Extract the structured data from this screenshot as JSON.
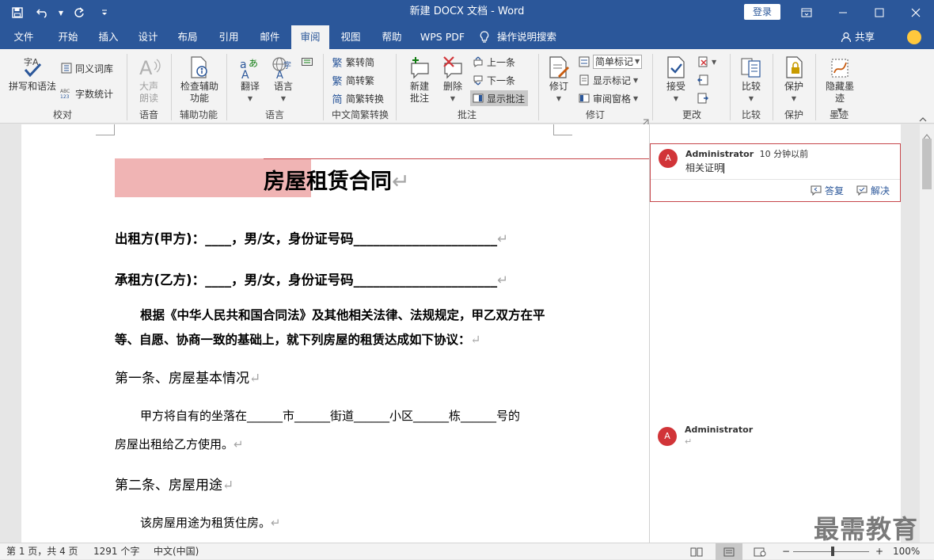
{
  "window": {
    "title": "新建 DOCX 文档 - Word",
    "login_label": "登录"
  },
  "tabs": [
    "文件",
    "开始",
    "插入",
    "设计",
    "布局",
    "引用",
    "邮件",
    "审阅",
    "视图",
    "帮助",
    "WPS PDF",
    "操作说明搜索"
  ],
  "active_tab": "审阅",
  "share_label": "共享",
  "ribbon": {
    "proofing": {
      "label": "校对",
      "spelling": "拼写和语法",
      "thesaurus": "同义词库",
      "wordcount": "字数统计"
    },
    "speech": {
      "label": "语音",
      "read_aloud": "大声朗读"
    },
    "accessibility": {
      "label": "辅助功能",
      "check": "检查辅助功能"
    },
    "language": {
      "label": "语言",
      "translate": "翻译",
      "language": "语言"
    },
    "chinese": {
      "label": "中文简繁转换",
      "trad_to_simp": "繁转简",
      "simp_to_trad": "简转繁",
      "convert": "简繁转换"
    },
    "comments": {
      "label": "批注",
      "new": "新建批注",
      "delete": "删除",
      "prev": "上一条",
      "next": "下一条",
      "show": "显示批注"
    },
    "tracking": {
      "label": "修订",
      "track": "修订",
      "markup_select": "简单标记",
      "show_markup": "显示标记",
      "reviewing_pane": "审阅窗格"
    },
    "changes": {
      "label": "更改",
      "accept": "接受"
    },
    "compare": {
      "label": "比较",
      "compare": "比较"
    },
    "protect": {
      "label": "保护",
      "protect": "保护"
    },
    "ink": {
      "label": "墨迹",
      "hide_ink": "隐藏墨迹"
    }
  },
  "document": {
    "title": "房屋租赁合同",
    "lessor": "出租方(甲方)：____，男/女，身份证号码______________________",
    "lessee": "承租方(乙方)：____，男/女，身份证号码______________________",
    "intro_1": "根据《中华人民共和国合同法》及其他相关法律、法规规定，甲乙双方在平",
    "intro_2": "等、自愿、协商一致的基础上，就下列房屋的租赁达成如下协议：",
    "article1_title": "第一条、房屋基本情况",
    "article1_body_1": "甲方将自有的坐落在______市______街道______小区______栋______号的",
    "article1_body_2": "房屋出租给乙方使用。",
    "article2_title": "第二条、房屋用途",
    "article2_body": "该房屋用途为租赁住房。",
    "para_mark": "↵"
  },
  "comments": [
    {
      "author": "Administrator",
      "time": "10 分钟以前",
      "text": "相关证明",
      "avatar": "A",
      "reply": "答复",
      "resolve": "解决"
    },
    {
      "author": "Administrator",
      "time": "",
      "text": "",
      "avatar": "A"
    }
  ],
  "status": {
    "page": "第 1 页，共 4 页",
    "words": "1291 个字",
    "language": "中文(中国)",
    "zoom": "100%",
    "zoom_minus": "−",
    "zoom_plus": "+"
  },
  "watermark": "最需教育",
  "colors": {
    "brand": "#2b579a",
    "comment_avatar": "#d13438",
    "highlight": "#f0b4b4",
    "comment_border": "#c6464b"
  }
}
